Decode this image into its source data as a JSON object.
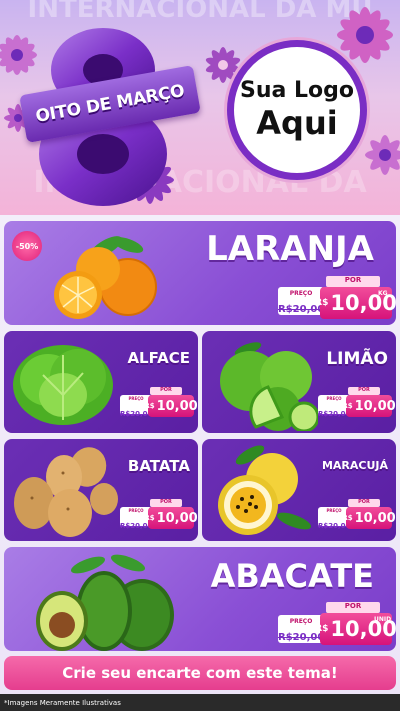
{
  "header": {
    "bg_text_top": "INTERNACIONAL DA MU",
    "bg_text_bottom": "INTERNACIONAL DA",
    "ribbon_text": "OITO DE MARÇO",
    "logo_line1": "Sua Logo",
    "logo_line2": "Aqui"
  },
  "products": [
    {
      "name": "LARANJA",
      "badge": "-50%",
      "por_label": "POR",
      "old_label": "PREÇO",
      "old_price": "R$20,00",
      "currency": "R$",
      "new_price": "10,00",
      "unit": "KG"
    },
    {
      "name": "ALFACE",
      "por_label": "POR",
      "old_label": "PREÇO",
      "old_price": "R$20,00",
      "currency": "R$",
      "new_price": "10,00"
    },
    {
      "name": "LIMÃO",
      "por_label": "POR",
      "old_label": "PREÇO",
      "old_price": "R$20,00",
      "currency": "R$",
      "new_price": "10,00"
    },
    {
      "name": "BATATA",
      "por_label": "POR",
      "old_label": "PREÇO",
      "old_price": "R$20,00",
      "currency": "R$",
      "new_price": "10,00"
    },
    {
      "name": "MARACUJÁ",
      "por_label": "POR",
      "old_label": "PREÇO",
      "old_price": "R$20,00",
      "currency": "R$",
      "new_price": "10,00"
    },
    {
      "name": "ABACATE",
      "por_label": "POR",
      "old_label": "PREÇO",
      "old_price": "R$20,00",
      "currency": "R$",
      "new_price": "10,00",
      "unit": "UNID"
    }
  ],
  "cta": "Crie seu encarte com este tema!",
  "footer": "*Imagens Meramente Ilustrativas",
  "colors": {
    "purple": "#7a3dc9",
    "pink": "#e53d8e",
    "dark_purple": "#5a1fa3"
  }
}
